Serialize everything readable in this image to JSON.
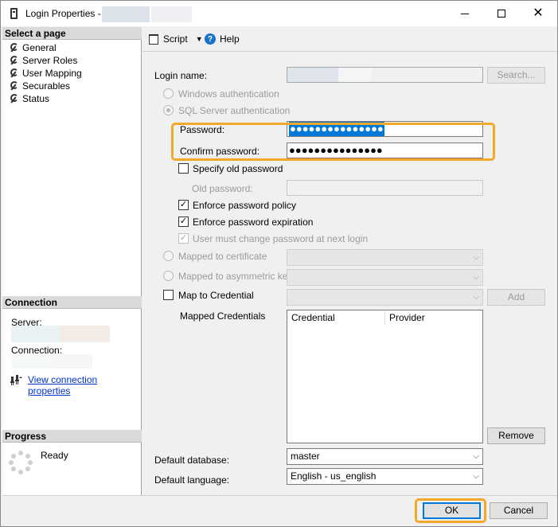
{
  "window": {
    "title": "Login Properties -",
    "minimize_symbol": "",
    "close_symbol": "✕"
  },
  "left_pane": {
    "select_page_header": "Select a page",
    "pages": [
      "General",
      "Server Roles",
      "User Mapping",
      "Securables",
      "Status"
    ],
    "connection_header": "Connection",
    "server_label": "Server:",
    "connection_label": "Connection:",
    "view_connection_link": "View connection properties",
    "progress_header": "Progress",
    "progress_status": "Ready"
  },
  "toolbar": {
    "script_label": "Script",
    "help_label": "Help",
    "caret": "▼",
    "help_glyph": "?"
  },
  "form": {
    "login_name_label": "Login name:",
    "search_button": "Search...",
    "windows_auth_label": "Windows authentication",
    "sql_auth_label": "SQL Server authentication",
    "password_label": "Password:",
    "password_value": "●●●●●●●●●●●●●●●",
    "confirm_password_label": "Confirm password:",
    "confirm_password_value": "●●●●●●●●●●●●●●●",
    "specify_old_password_label": "Specify old password",
    "old_password_label": "Old password:",
    "enforce_policy_label": "Enforce password policy",
    "enforce_expiration_label": "Enforce password expiration",
    "must_change_label": "User must change password at next login",
    "mapped_certificate_label": "Mapped to certificate",
    "mapped_asymmetric_key_label": "Mapped to asymmetric key",
    "map_to_credential_label": "Map to Credential",
    "add_button": "Add",
    "mapped_credentials_label": "Mapped Credentials",
    "credentials_columns": [
      "Credential",
      "Provider"
    ],
    "remove_button": "Remove",
    "default_database_label": "Default database:",
    "default_database_value": "master",
    "default_language_label": "Default language:",
    "default_language_value": "English - us_english",
    "check_glyph": "✓",
    "combo_arrow": "⌵"
  },
  "footer": {
    "ok_button": "OK",
    "cancel_button": "Cancel"
  },
  "colors": {
    "highlight": "#f0a92a",
    "link": "#0033cc",
    "selection": "#0078d7"
  }
}
